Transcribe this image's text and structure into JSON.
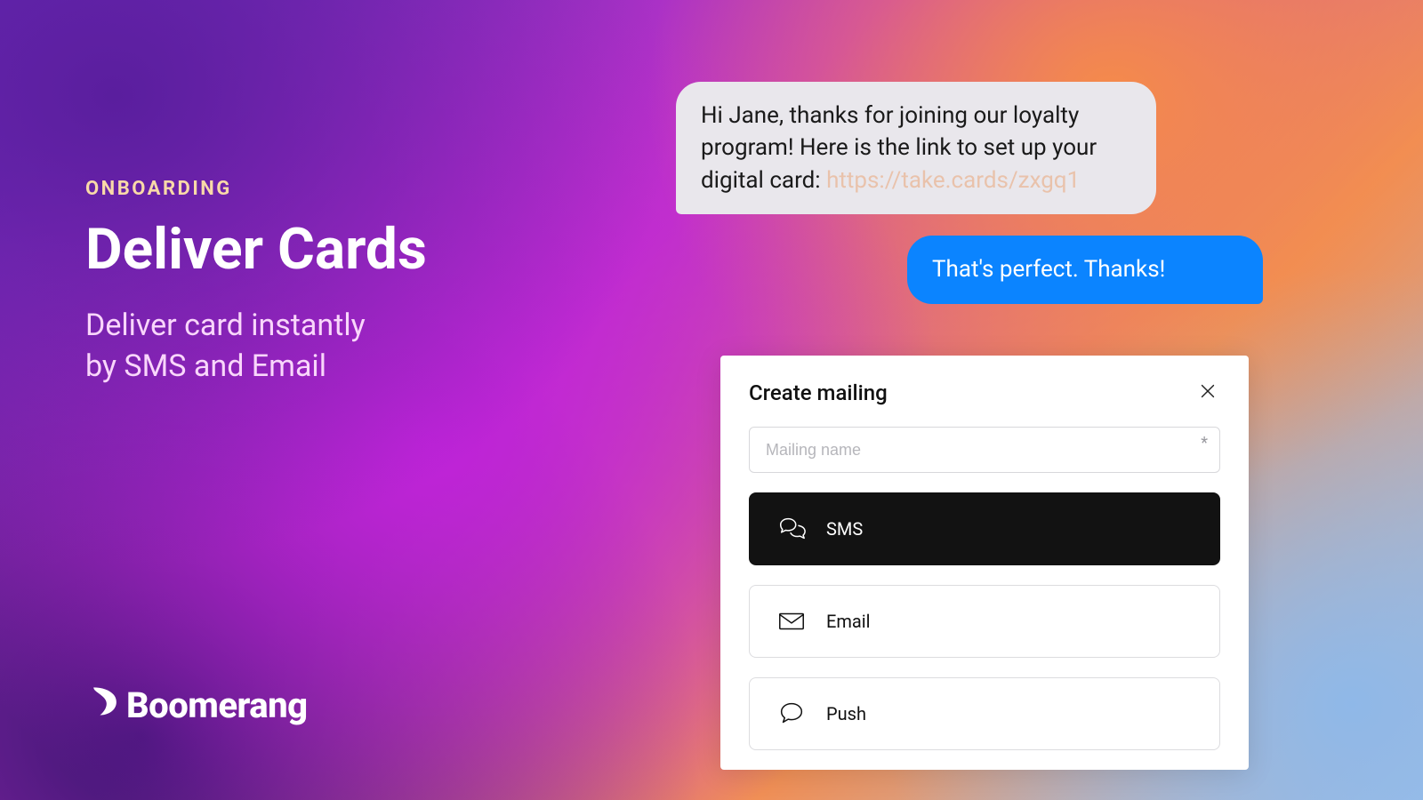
{
  "copy": {
    "eyebrow": "ONBOARDING",
    "headline": "Deliver Cards",
    "subhead_line1": "Deliver card instantly",
    "subhead_line2": "by SMS and Email"
  },
  "brand": {
    "name": "Boomerang"
  },
  "chat": {
    "incoming_text": "Hi Jane, thanks for joining our loyalty program! Here is the link to set up your digital card:",
    "incoming_link": "https://take.cards/zxgq1",
    "outgoing_text": "That's perfect. Thanks!"
  },
  "panel": {
    "title": "Create mailing",
    "input_placeholder": "Mailing name",
    "required_mark": "*",
    "options": {
      "sms": "SMS",
      "email": "Email",
      "push": "Push"
    }
  }
}
